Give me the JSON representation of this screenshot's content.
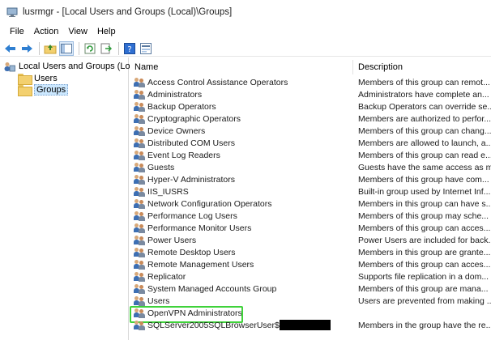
{
  "window": {
    "title": "lusrmgr - [Local Users and Groups (Local)\\Groups]"
  },
  "menu": [
    "File",
    "Action",
    "View",
    "Help"
  ],
  "toolbar": {
    "buttons": [
      "back-icon",
      "forward-icon",
      "up-folder-icon",
      "show-hide-tree-icon",
      "refresh-icon",
      "export-list-icon",
      "help-icon",
      "properties-icon"
    ]
  },
  "tree": {
    "root": "Local Users and Groups (Local)",
    "children": [
      "Users",
      "Groups"
    ],
    "selected": "Groups"
  },
  "list": {
    "columns": [
      "Name",
      "Description"
    ],
    "rows": [
      {
        "name": "Access Control Assistance Operators",
        "desc": "Members of this group can remot..."
      },
      {
        "name": "Administrators",
        "desc": "Administrators have complete an..."
      },
      {
        "name": "Backup Operators",
        "desc": "Backup Operators can override se..."
      },
      {
        "name": "Cryptographic Operators",
        "desc": "Members are authorized to perfor..."
      },
      {
        "name": "Device Owners",
        "desc": "Members of this group can chang..."
      },
      {
        "name": "Distributed COM Users",
        "desc": "Members are allowed to launch, a..."
      },
      {
        "name": "Event Log Readers",
        "desc": "Members of this group can read e..."
      },
      {
        "name": "Guests",
        "desc": "Guests have the same access as m..."
      },
      {
        "name": "Hyper-V Administrators",
        "desc": "Members of this group have com..."
      },
      {
        "name": "IIS_IUSRS",
        "desc": "Built-in group used by Internet Inf..."
      },
      {
        "name": "Network Configuration Operators",
        "desc": "Members in this group can have s..."
      },
      {
        "name": "Performance Log Users",
        "desc": "Members of this group may sche..."
      },
      {
        "name": "Performance Monitor Users",
        "desc": "Members of this group can acces..."
      },
      {
        "name": "Power Users",
        "desc": "Power Users are included for back..."
      },
      {
        "name": "Remote Desktop Users",
        "desc": "Members in this group are grante..."
      },
      {
        "name": "Remote Management Users",
        "desc": "Members of this group can acces..."
      },
      {
        "name": "Replicator",
        "desc": "Supports file replication in a dom..."
      },
      {
        "name": "System Managed Accounts Group",
        "desc": "Members of this group are mana..."
      },
      {
        "name": "Users",
        "desc": "Users are prevented from making ..."
      },
      {
        "name": "OpenVPN Administrators",
        "desc": ""
      },
      {
        "name": "SQLServer2005SQLBrowserUser$",
        "desc": "Members in the group have the re..."
      }
    ],
    "highlighted_row": "OpenVPN Administrators"
  },
  "colors": {
    "highlight_outline": "#3fd23a",
    "tree_selection": "#cce8ff"
  }
}
